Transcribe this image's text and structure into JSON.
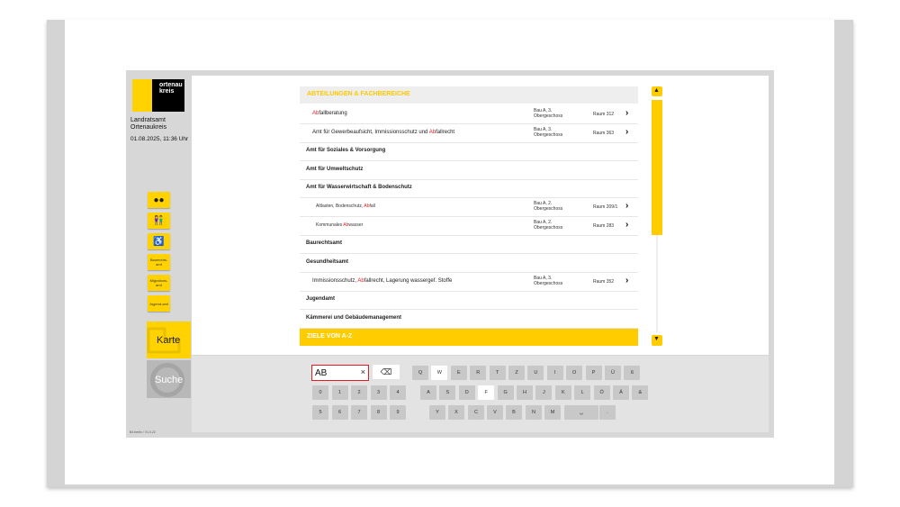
{
  "sidebar": {
    "logo_text": [
      "ortenau",
      "kreis"
    ],
    "org_name": [
      "Landratsamt",
      "Ortenaukreis"
    ],
    "datetime": "01.08.2025, 11:36 Uhr",
    "quick_buttons": [
      {
        "icon": "chat-bubbles-icon",
        "label": ""
      },
      {
        "icon": "restroom-icon",
        "label": ""
      },
      {
        "icon": "wheelchair-icon",
        "label": ""
      },
      {
        "icon": "",
        "label": "Baurechts-amt"
      },
      {
        "icon": "",
        "label": "Migrations-amt"
      },
      {
        "icon": "",
        "label": "Jugend-amt"
      }
    ],
    "karte_label": "Karte",
    "suche_label": "Suche",
    "version": "B4 berlin / V1.0.22"
  },
  "list": {
    "header": "ABTEILUNGEN & FACHBEREICHE",
    "rows": [
      {
        "level": "sub",
        "pre": "",
        "hl": "Ab",
        "post": "fallberatung",
        "bldg1": "Bau A, 3.",
        "bldg2": "Obergeschoss",
        "room": "Raum 312",
        "chevron": true
      },
      {
        "level": "sub",
        "pre": "Amt für Gewerbeaufsicht, Immissionsschutz und ",
        "hl": "Ab",
        "post": "fallrecht",
        "bldg1": "Bau A, 3.",
        "bldg2": "Obergeschoss",
        "room": "Raum 363",
        "chevron": true
      },
      {
        "level": "top",
        "pre": "Amt für Soziales & Vorsorgung",
        "hl": "",
        "post": "",
        "bldg1": "",
        "bldg2": "",
        "room": "",
        "chevron": false
      },
      {
        "level": "top",
        "pre": "Amt für Umweltschutz",
        "hl": "",
        "post": "",
        "bldg1": "",
        "bldg2": "",
        "room": "",
        "chevron": false
      },
      {
        "level": "top",
        "pre": "Amt für Wasserwirtschaft & Bodenschutz",
        "hl": "",
        "post": "",
        "bldg1": "",
        "bldg2": "",
        "room": "",
        "chevron": false
      },
      {
        "level": "sub2",
        "pre": "Altlasten, Bodenschutz, ",
        "hl": "Ab",
        "post": "fall",
        "bldg1": "Bau A, 2.",
        "bldg2": "Obergeschoss",
        "room": "Raum 209/1",
        "chevron": true
      },
      {
        "level": "sub2",
        "pre": "Kommunales ",
        "hl": "Ab",
        "post": "wasser",
        "bldg1": "Bau A, 2.",
        "bldg2": "Obergeschoss",
        "room": "Raum 283",
        "chevron": true
      },
      {
        "level": "top",
        "pre": "Baurechtsamt",
        "hl": "",
        "post": "",
        "bldg1": "",
        "bldg2": "",
        "room": "",
        "chevron": false
      },
      {
        "level": "top",
        "pre": "Gesundheitsamt",
        "hl": "",
        "post": "",
        "bldg1": "",
        "bldg2": "",
        "room": "",
        "chevron": false
      },
      {
        "level": "sub",
        "pre": "Immissionsschutz, ",
        "hl": "Ab",
        "post": "fallrecht, Lagerung wassergef. Stoffe",
        "bldg1": "Bau A, 3.",
        "bldg2": "Obergeschoss",
        "room": "Raum 352",
        "chevron": true
      },
      {
        "level": "top",
        "pre": "Jugendamt",
        "hl": "",
        "post": "",
        "bldg1": "",
        "bldg2": "",
        "room": "",
        "chevron": false
      },
      {
        "level": "top",
        "pre": "Kämmerei und Gebäudemanagement",
        "hl": "",
        "post": "",
        "bldg1": "",
        "bldg2": "",
        "room": "",
        "chevron": false
      }
    ],
    "footer": "ZIELE VON A-Z",
    "chevron_glyph": "›"
  },
  "keyboard": {
    "search_value": "AB",
    "clear_glyph": "×",
    "backspace_glyph": "⌫",
    "row1": [
      "Q",
      "W",
      "E",
      "R",
      "T",
      "Z",
      "U",
      "I",
      "O",
      "P",
      "Ü",
      "ß"
    ],
    "row2": [
      "A",
      "S",
      "D",
      "F",
      "G",
      "H",
      "J",
      "K",
      "L",
      "Ö",
      "Ä",
      "&"
    ],
    "row3": [
      "Y",
      "X",
      "C",
      "V",
      "B",
      "N",
      "M",
      "␣",
      "."
    ],
    "digits1": [
      "0",
      "1",
      "2",
      "3",
      "4"
    ],
    "digits2": [
      "5",
      "6",
      "7",
      "8",
      "9"
    ],
    "highlighted_keys": [
      "W",
      "F"
    ]
  },
  "colors": {
    "accent": "#ffcc00",
    "highlight": "#e31b23"
  }
}
